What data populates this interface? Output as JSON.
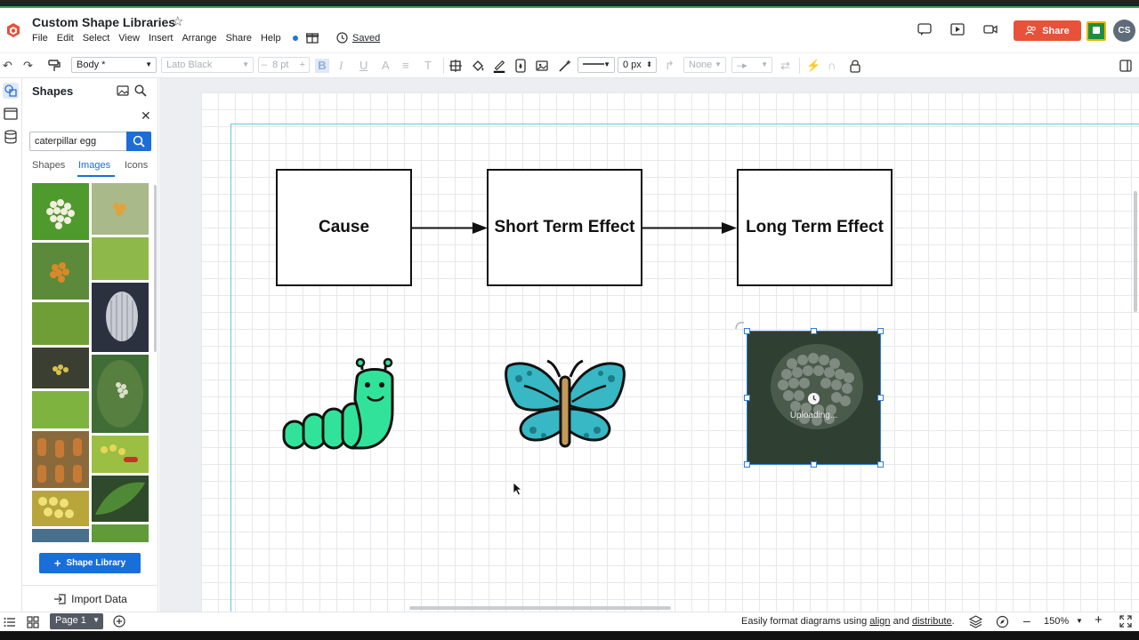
{
  "app": {
    "doc_title": "Custom Shape Libraries",
    "menu": [
      "File",
      "Edit",
      "Select",
      "View",
      "Insert",
      "Arrange",
      "Share",
      "Help"
    ],
    "saved_label": "Saved",
    "share_label": "Share",
    "avatar_initials": "CS",
    "accent": "#1a6ed8",
    "share_color": "#e8513a"
  },
  "toolbar": {
    "font_style": "Body *",
    "font_family": "Lato Black",
    "font_size": "8 pt",
    "line_width": "0 px",
    "arrow_none": "None"
  },
  "panel": {
    "title": "Shapes",
    "search": {
      "value": "caterpillar egg",
      "placeholder": "Search"
    },
    "tabs": [
      {
        "label": "Shapes",
        "active": false
      },
      {
        "label": "Images",
        "active": true
      },
      {
        "label": "Icons",
        "active": false
      }
    ],
    "shape_library_label": "Shape Library",
    "import_label": "Import Data"
  },
  "diagram": {
    "nodes": [
      "Cause",
      "Short Term Effect",
      "Long Term Effect"
    ],
    "uploading_label": "Uploading..."
  },
  "footer": {
    "page_label": "Page 1",
    "hint_prefix": "Easily format diagrams using ",
    "hint_link1": "align",
    "hint_mid": " and ",
    "hint_link2": "distribute",
    "hint_suffix": ".",
    "zoom": "150%"
  }
}
